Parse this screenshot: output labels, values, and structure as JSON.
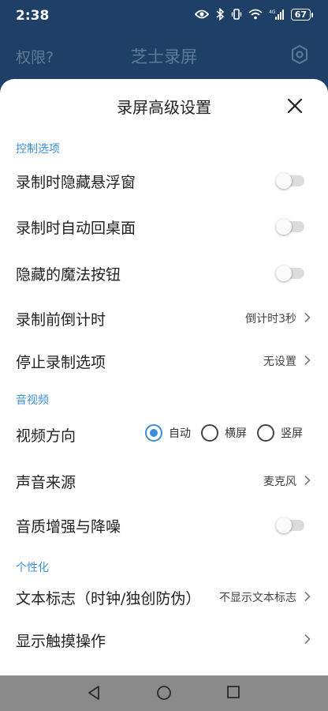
{
  "status_bar": {
    "time": "2:38",
    "battery": "67"
  },
  "app_header": {
    "left_label": "权限?",
    "title": "芝士录屏"
  },
  "sheet": {
    "title": "录屏高级设置",
    "sections": {
      "control": {
        "title": "控制选项",
        "hide_float": {
          "label": "录制时隐藏悬浮窗",
          "on": false
        },
        "auto_home": {
          "label": "录制时自动回桌面",
          "on": false
        },
        "hide_magic": {
          "label": "隐藏的魔法按钮",
          "on": false
        },
        "countdown": {
          "label": "录制前倒计时",
          "value": "倒计时3秒"
        },
        "stop_option": {
          "label": "停止录制选项",
          "value": "无设置"
        }
      },
      "av": {
        "title": "音视频",
        "orientation": {
          "label": "视频方向",
          "options": [
            "自动",
            "横屏",
            "竖屏"
          ],
          "selected": "自动"
        },
        "audio_source": {
          "label": "声音来源",
          "value": "麦克风"
        },
        "enhance": {
          "label": "音质增强与降噪",
          "on": false
        }
      },
      "personal": {
        "title": "个性化",
        "text_mark": {
          "label": "文本标志（时钟/独创防伪）",
          "value": "不显示文本标志"
        },
        "show_touch": {
          "label": "显示触摸操作"
        }
      }
    }
  },
  "colors": {
    "accent": "#3b8fd9",
    "header_bg": "#1e3f66",
    "nav_bg": "#8a8a8a"
  }
}
